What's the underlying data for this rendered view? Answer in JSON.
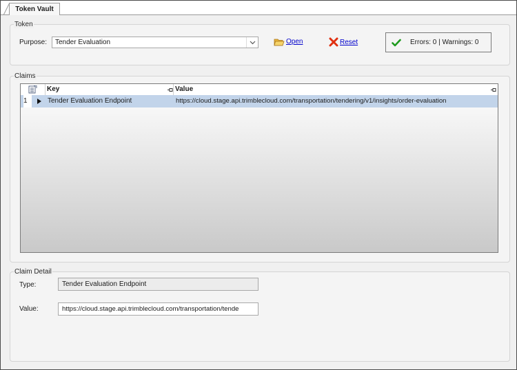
{
  "tab": {
    "label": "Token Vault"
  },
  "token": {
    "group_title": "Token",
    "purpose_label": "Purpose:",
    "purpose_value": "Tender Evaluation",
    "open_label": "Open",
    "reset_label": "Reset",
    "status_text": "Errors: 0 | Warnings: 0"
  },
  "claims": {
    "group_title": "Claims",
    "columns": {
      "key": "Key",
      "value": "Value"
    },
    "rows": [
      {
        "num": "1",
        "key": "Tender Evaluation Endpoint",
        "value": "https://cloud.stage.api.trimblecloud.com/transportation/tendering/v1/insights/order-evaluation"
      }
    ]
  },
  "detail": {
    "group_title": "Claim Detail",
    "type_label": "Type:",
    "type_value": "Tender Evaluation Endpoint",
    "value_label": "Value:",
    "value_value": "https://cloud.stage.api.trimblecloud.com/transportation/tende"
  },
  "colors": {
    "row_selected": "#c2d4ea",
    "link": "#0000cc",
    "ok_check": "#1d9a1d",
    "reset_x": "#e03010",
    "open_folder": "#e9b43a"
  }
}
